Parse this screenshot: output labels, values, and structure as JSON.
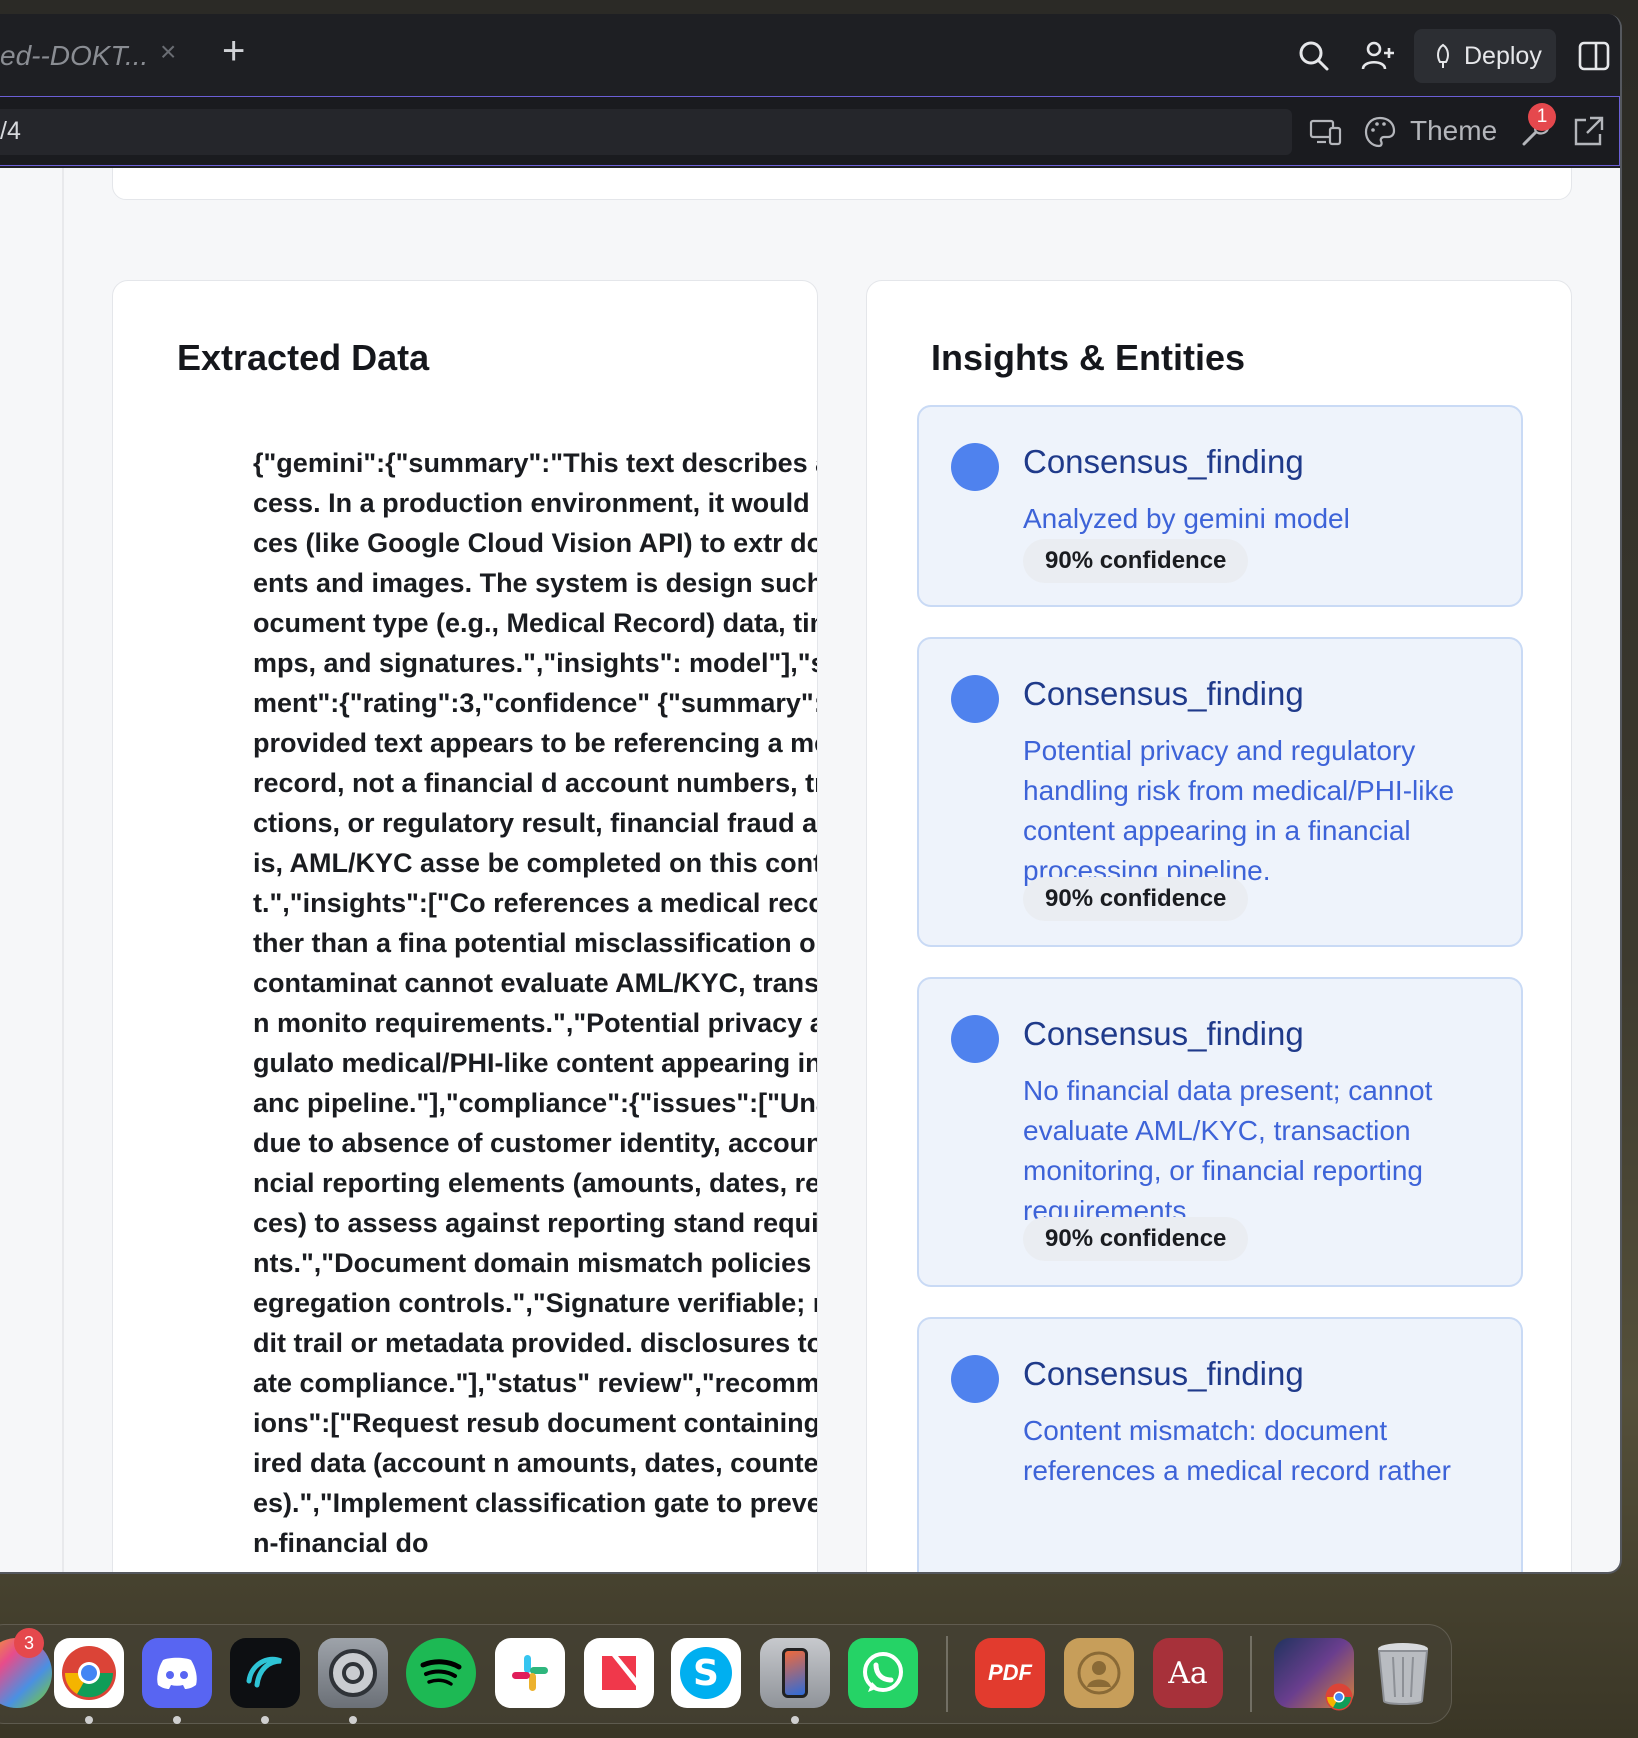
{
  "browser": {
    "tab_title": "ed--DOKT...",
    "deploy_label": "Deploy",
    "url_fragment": "/4",
    "theme_label": "Theme",
    "notification_count": "1"
  },
  "extracted": {
    "title": "Extracted Data",
    "json_text": "{\"gemini\":{\"summary\":\"This text describes a process. In a production environment, it would services (like Google Cloud Vision API) to extr documents and images. The system is design such as document type (e.g., Medical Record) data, timestamps, and signatures.\",\"insights\": model\"],\"sentiment\":{\"rating\":3,\"confidence\" {\"summary\":\"The provided text appears to be referencing a medical record, not a financial d account numbers, transactions, or regulatory result, financial fraud analysis, AML/KYC asse be completed on this content.\",\"insights\":[\"Co references a medical record rather than a fina potential misclassification or data contaminat cannot evaluate AML/KYC, transaction monito requirements.\",\"Potential privacy and regulato medical/PHI-like content appearing in a financ pipeline.\"],\"compliance\":{\"issues\":[\"Unable t due to absence of customer identity, account financial reporting elements (amounts, dates, references) to assess against reporting stand requirements.\",\"Document domain mismatch policies and segregation controls.\",\"Signature verifiable; no audit trail or metadata provided. disclosures to validate compliance.\"],\"status\" review\",\"recommendations\":[\"Request resub document containing required data (account n amounts, dates, counterparties).\",\"Implement classification gate to prevent non-financial do"
  },
  "insights": {
    "title": "Insights & Entities",
    "items": [
      {
        "title": "Consensus_finding",
        "description": "Analyzed by gemini model",
        "confidence": "90% confidence"
      },
      {
        "title": "Consensus_finding",
        "description": "Potential privacy and regulatory handling risk from medical/PHI-like content appearing in a financial processing pipeline.",
        "confidence": "90% confidence"
      },
      {
        "title": "Consensus_finding",
        "description": "No financial data present; cannot evaluate AML/KYC, transaction monitoring, or financial reporting requirements.",
        "confidence": "90% confidence"
      },
      {
        "title": "Consensus_finding",
        "description": "Content mismatch: document references a medical record rather",
        "confidence": ""
      }
    ]
  },
  "dock": {
    "photos_badge": "3",
    "pdf_label": "PDF",
    "dictionary_label": "Aa",
    "apps": [
      "photos",
      "chrome",
      "discord",
      "visual-studio-code-insiders",
      "system-settings",
      "spotify",
      "slack",
      "news",
      "skype",
      "iphone-mirroring",
      "whatsapp",
      "pdf-expert",
      "contacts",
      "dictionary",
      "browser-window-preview",
      "trash"
    ]
  }
}
